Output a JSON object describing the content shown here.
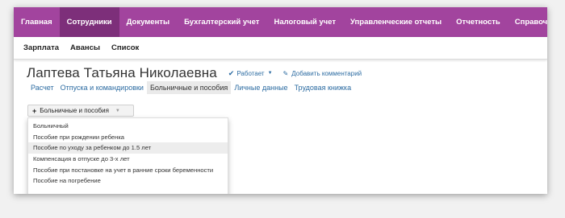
{
  "topnav": {
    "items": [
      {
        "label": "Главная"
      },
      {
        "label": "Сотрудники"
      },
      {
        "label": "Документы"
      },
      {
        "label": "Бухгалтерский учет"
      },
      {
        "label": "Налоговый учет"
      },
      {
        "label": "Управленческие отчеты"
      },
      {
        "label": "Отчетность"
      },
      {
        "label": "Справочники"
      }
    ],
    "active_index": 1
  },
  "subnav": {
    "items": [
      {
        "label": "Зарплата"
      },
      {
        "label": "Авансы"
      },
      {
        "label": "Список"
      }
    ]
  },
  "header": {
    "name": "Лаптева Татьяна Николаевна",
    "status_label": "Работает",
    "add_comment_label": "Добавить комментарий"
  },
  "tabs": {
    "items": [
      {
        "label": "Расчет"
      },
      {
        "label": "Отпуска и командировки"
      },
      {
        "label": "Больничные и пособия"
      },
      {
        "label": "Личные данные"
      },
      {
        "label": "Трудовая книжка"
      }
    ],
    "active_index": 2
  },
  "dropdown": {
    "label": "Больничные и пособия",
    "items": [
      {
        "label": "Больничный"
      },
      {
        "label": "Пособие при рождении ребенка"
      },
      {
        "label": "Пособие по уходу за ребенком до 1.5 лет"
      },
      {
        "label": "Компенсация в отпуске до 3-х лет"
      },
      {
        "label": "Пособие при постановке на учет в ранние сроки беременности"
      },
      {
        "label": "Пособие на погребение"
      }
    ],
    "highlighted_index": 2
  },
  "colors": {
    "nav_bg": "#a2449e",
    "nav_active_bg": "#7d2f7a",
    "link": "#2d6ca2"
  }
}
